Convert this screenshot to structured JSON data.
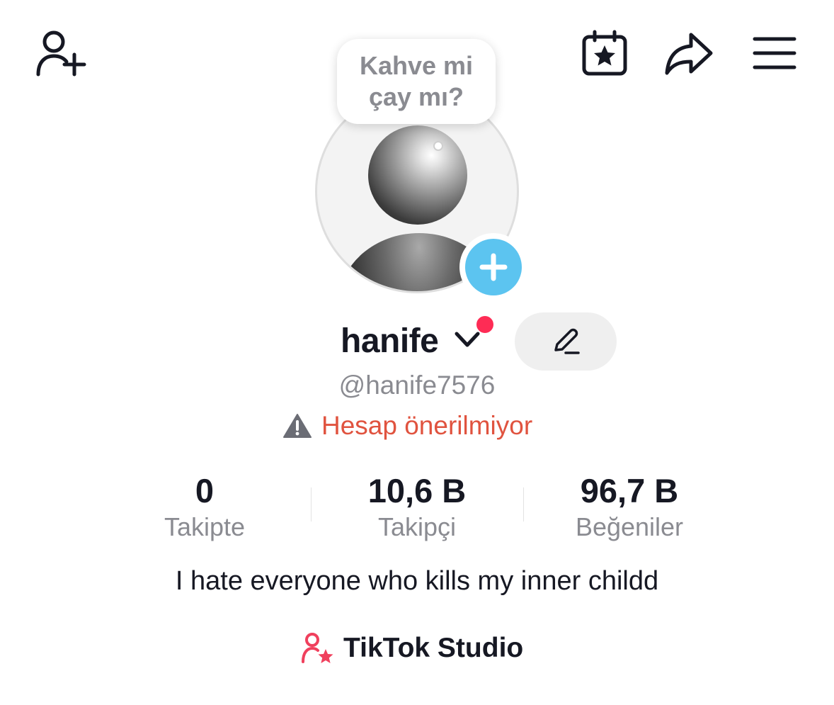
{
  "header": {
    "add_friend_icon": "person-plus-icon",
    "calendar_icon": "calendar-star-icon",
    "share_icon": "share-arrow-icon",
    "menu_icon": "hamburger-menu-icon"
  },
  "avatar": {
    "note": "Kahve mi çay mı?",
    "add_icon": "plus-icon",
    "add_color": "#5cc4f0"
  },
  "profile": {
    "name": "hanife",
    "handle": "@hanife7576",
    "warning": "Hesap önerilmiyor",
    "warning_color": "#e0533f",
    "notification_dot_color": "#fe2c55"
  },
  "stats": [
    {
      "value": "0",
      "label": "Takipte"
    },
    {
      "value": "10,6 B",
      "label": "Takipçi"
    },
    {
      "value": "96,7 B",
      "label": "Beğeniler"
    }
  ],
  "bio": "I hate everyone who kills my inner childd",
  "studio": {
    "label": "TikTok Studio",
    "icon": "person-star-icon",
    "icon_color": "#f0405d"
  }
}
